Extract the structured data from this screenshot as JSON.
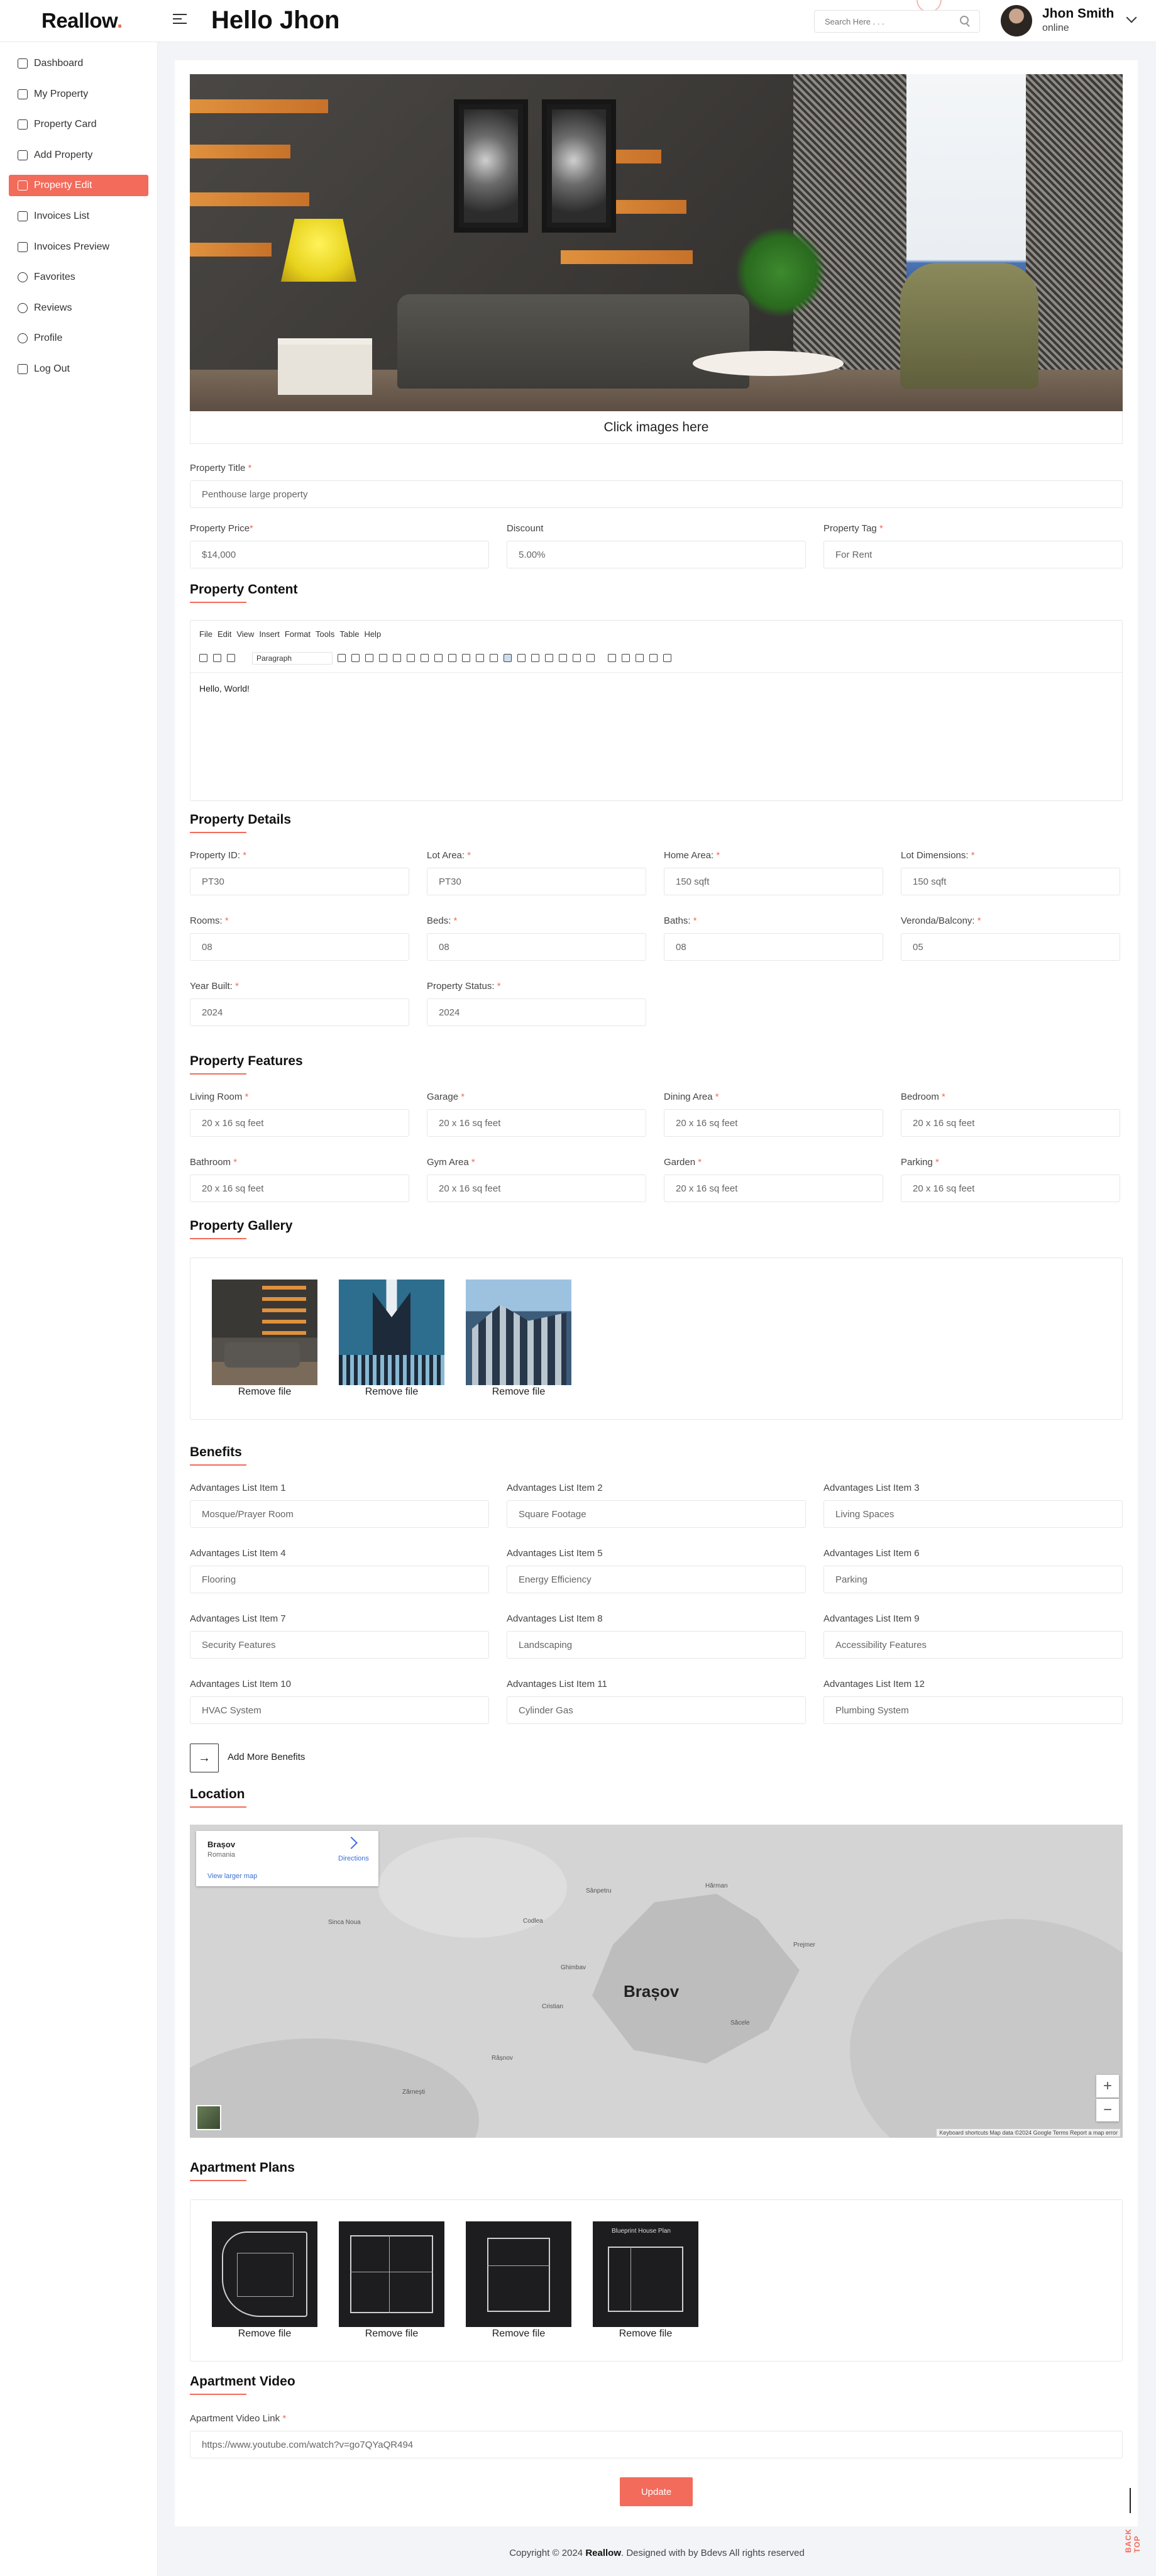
{
  "header": {
    "brand": "Reallow",
    "brand_dot": ".",
    "page_title": "Hello Jhon",
    "search_placeholder": "Search Here . . .",
    "user_name": "Jhon Smith",
    "user_status": "online"
  },
  "sidebar": {
    "items": [
      {
        "label": "Dashboard",
        "icon": "dashboard-icon"
      },
      {
        "label": "My Property",
        "icon": "building-icon"
      },
      {
        "label": "Property Card",
        "icon": "card-icon"
      },
      {
        "label": "Add Property",
        "icon": "add-icon"
      },
      {
        "label": "Property Edit",
        "icon": "edit-icon",
        "active": true
      },
      {
        "label": "Invoices List",
        "icon": "document-icon"
      },
      {
        "label": "Invoices Preview",
        "icon": "document-icon"
      },
      {
        "label": "Favorites",
        "icon": "heart-icon"
      },
      {
        "label": "Reviews",
        "icon": "chat-icon"
      },
      {
        "label": "Profile",
        "icon": "user-icon"
      },
      {
        "label": "Log Out",
        "icon": "logout-icon"
      }
    ]
  },
  "hero": {
    "caption": "Click images here"
  },
  "basic": {
    "title_label": "Property Title",
    "title_value": "Penthouse large property",
    "price_label": "Property Price",
    "price_value": "$14,000",
    "discount_label": "Discount",
    "discount_value": "5.00%",
    "tag_label": "Property Tag",
    "tag_value": "For Rent",
    "req": "*"
  },
  "content": {
    "title": "Property Content",
    "menu": [
      "File",
      "Edit",
      "View",
      "Insert",
      "Format",
      "Tools",
      "Table",
      "Help"
    ],
    "format_select": "Paragraph",
    "body": "Hello, World!"
  },
  "details": {
    "title": "Property Details",
    "fields": [
      {
        "label": "Property ID:",
        "value": "PT30"
      },
      {
        "label": "Lot Area:",
        "value": "PT30"
      },
      {
        "label": "Home Area:",
        "value": "150 sqft"
      },
      {
        "label": "Lot Dimensions:",
        "value": "150 sqft"
      },
      {
        "label": "Rooms:",
        "value": "08"
      },
      {
        "label": "Beds:",
        "value": "08"
      },
      {
        "label": "Baths:",
        "value": "08"
      },
      {
        "label": "Veronda/Balcony:",
        "value": "05"
      },
      {
        "label": "Year Built:",
        "value": "2024"
      },
      {
        "label": "Property Status:",
        "value": "2024"
      }
    ]
  },
  "features": {
    "title": "Property Features",
    "fields": [
      {
        "label": "Living Room",
        "value": "20 x 16 sq feet"
      },
      {
        "label": "Garage",
        "value": "20 x 16 sq feet"
      },
      {
        "label": "Dining Area",
        "value": "20 x 16 sq feet"
      },
      {
        "label": "Bedroom",
        "value": "20 x 16 sq feet"
      },
      {
        "label": "Bathroom",
        "value": "20 x 16 sq feet"
      },
      {
        "label": "Gym Area",
        "value": "20 x 16 sq feet"
      },
      {
        "label": "Garden",
        "value": "20 x 16 sq feet"
      },
      {
        "label": "Parking",
        "value": "20 x 16 sq feet"
      }
    ]
  },
  "gallery": {
    "title": "Property Gallery",
    "items": [
      {
        "caption": "Remove file"
      },
      {
        "caption": "Remove file"
      },
      {
        "caption": "Remove file"
      }
    ]
  },
  "benefits": {
    "title": "Benefits",
    "fields": [
      {
        "label": "Advantages List Item 1",
        "value": "Mosque/Prayer Room"
      },
      {
        "label": "Advantages List Item 2",
        "value": "Square Footage"
      },
      {
        "label": "Advantages List Item 3",
        "value": "Living Spaces"
      },
      {
        "label": "Advantages List Item 4",
        "value": "Flooring"
      },
      {
        "label": "Advantages List Item 5",
        "value": "Energy Efficiency"
      },
      {
        "label": "Advantages List Item 6",
        "value": "Parking"
      },
      {
        "label": "Advantages List Item 7",
        "value": "Security Features"
      },
      {
        "label": "Advantages List Item 8",
        "value": "Landscaping"
      },
      {
        "label": "Advantages List Item 9",
        "value": "Accessibility Features"
      },
      {
        "label": "Advantages List Item 10",
        "value": "HVAC System"
      },
      {
        "label": "Advantages List Item 11",
        "value": "Cylinder Gas"
      },
      {
        "label": "Advantages List Item 12",
        "value": "Plumbing System"
      }
    ],
    "add_more": "Add More Benefits"
  },
  "location": {
    "title": "Location",
    "card_title": "Brașov",
    "card_subtitle": "Romania",
    "card_link": "View larger map",
    "directions": "Directions",
    "city": "Brașov",
    "labels": [
      "Sânpetru",
      "Codlea",
      "Ghimbav",
      "Cristian",
      "Râșnov",
      "Prejmer",
      "Zărnești",
      "Săcele",
      "Sinca Noua",
      "Hărman"
    ],
    "footer": "Keyboard shortcuts   Map data ©2024 Google   Terms   Report a map error",
    "zoom_in": "+",
    "zoom_out": "−"
  },
  "plans": {
    "title": "Apartment Plans",
    "items": [
      {
        "caption": "Remove file"
      },
      {
        "caption": "Remove file"
      },
      {
        "caption": "Remove file"
      },
      {
        "caption": "Remove file"
      }
    ],
    "plan4_label": "Blueprint House Plan"
  },
  "video": {
    "title": "Apartment Video",
    "label": "Apartment Video Link",
    "value": "https://www.youtube.com/watch?v=go7QYaQR494"
  },
  "actions": {
    "update": "Update"
  },
  "footer": {
    "prefix": "Copyright © 2024 ",
    "brand": "Reallow",
    "suffix": ". Designed with by Bdevs All rights reserved",
    "back_top": "BACK TOP"
  },
  "colors": {
    "accent": "#f26b5b"
  }
}
